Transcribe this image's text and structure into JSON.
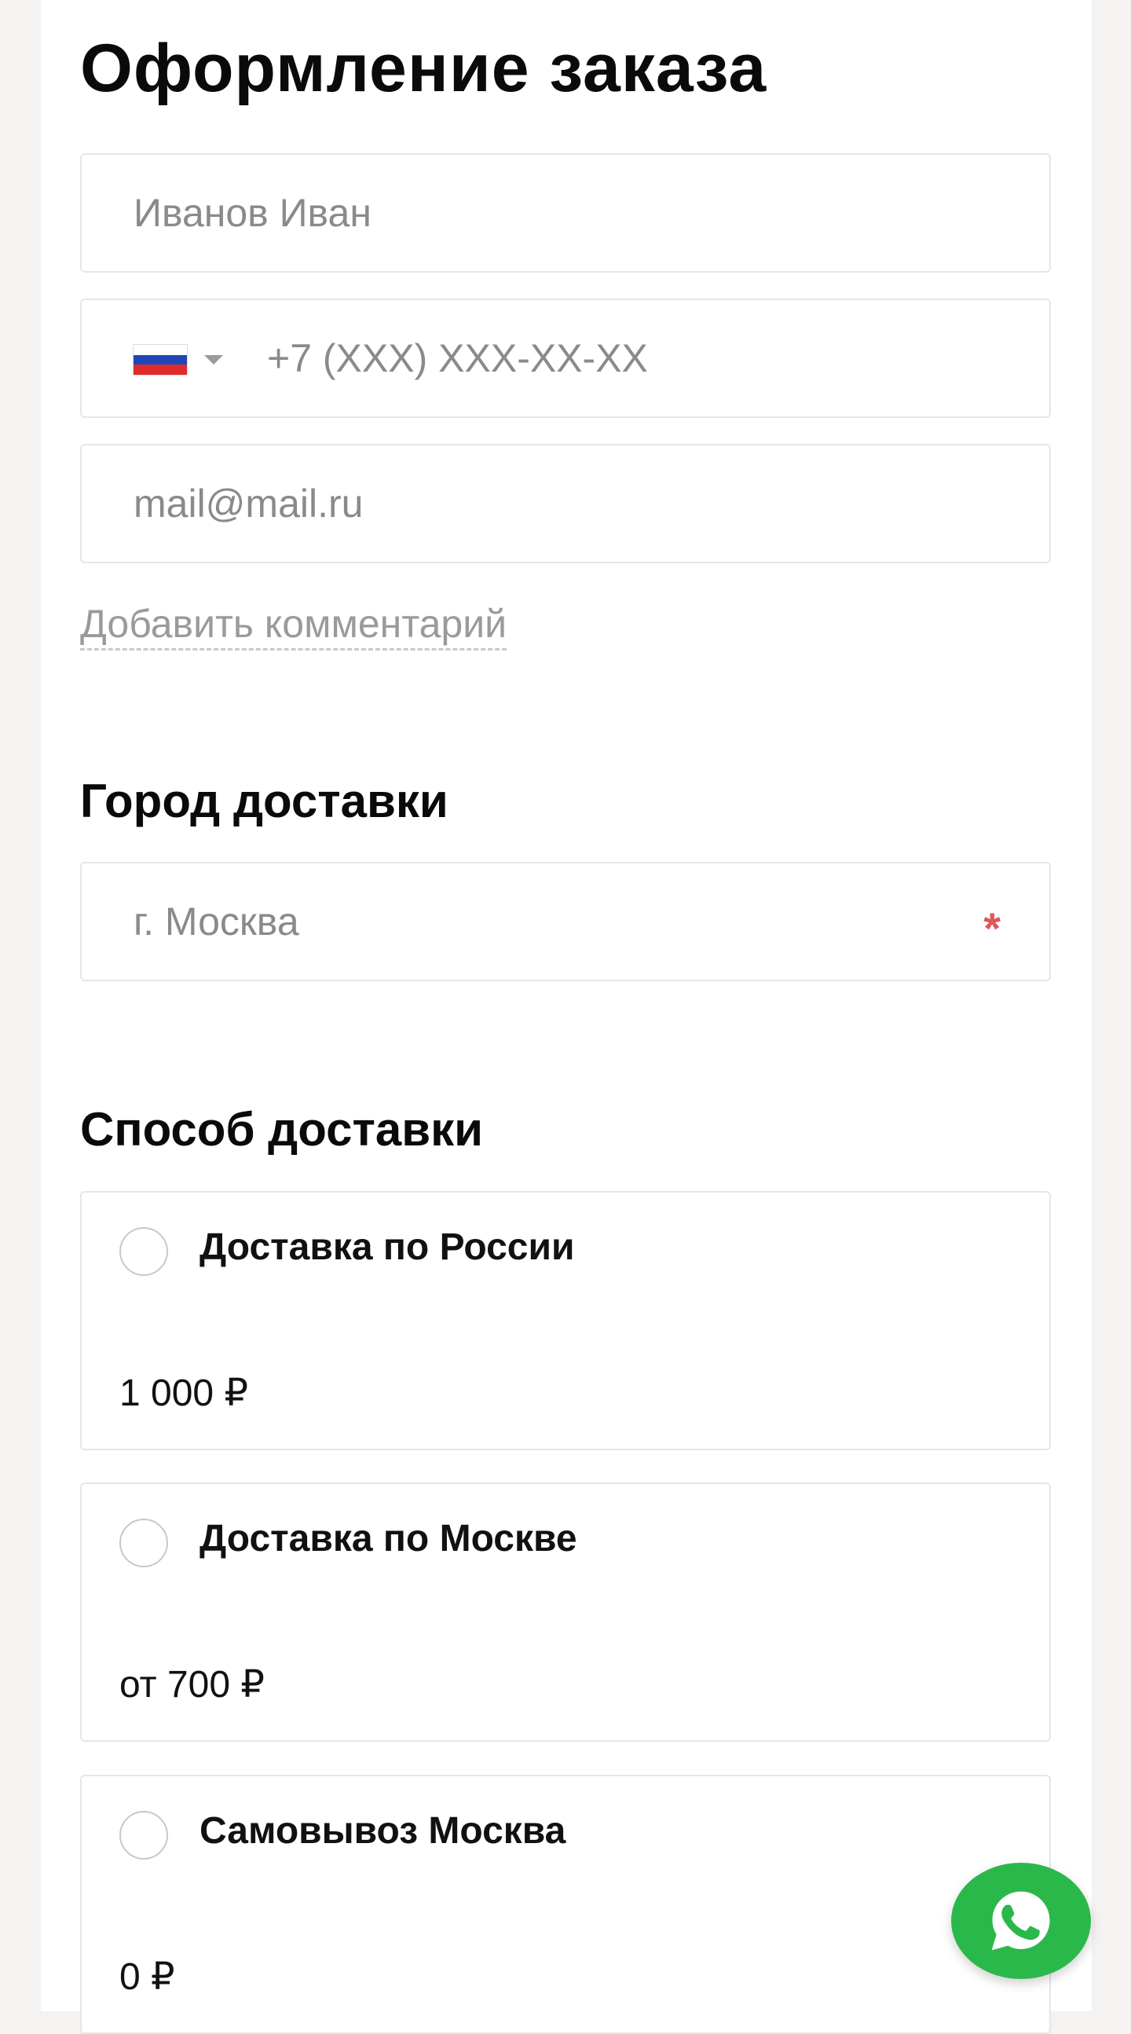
{
  "checkout": {
    "title": "Оформление заказа",
    "name_placeholder": "Иванов Иван",
    "phone_country": "RU",
    "phone_placeholder": "+7 (XXX) XXX-XX-XX",
    "email_placeholder": "mail@mail.ru",
    "add_comment_label": "Добавить комментарий"
  },
  "city": {
    "section_title": "Город доставки",
    "placeholder": "г. Москва",
    "required_mark": "*"
  },
  "delivery": {
    "section_title": "Способ доставки",
    "options": [
      {
        "title": "Доставка по России",
        "price": "1 000 ₽"
      },
      {
        "title": "Доставка по Москве",
        "price": "от 700 ₽"
      },
      {
        "title": "Самовывоз Москва",
        "price": "0 ₽"
      }
    ]
  },
  "fab": {
    "icon": "whatsapp-icon",
    "color": "#2ab84a"
  },
  "colors": {
    "background": "#f4f3f1",
    "card": "#ffffff",
    "required": "#e05757"
  }
}
